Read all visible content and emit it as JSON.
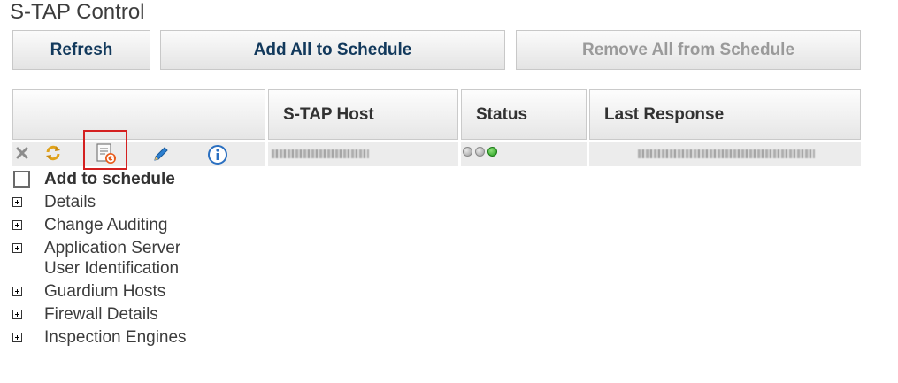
{
  "title": "S-TAP Control",
  "toolbar": {
    "refresh": "Refresh",
    "add_all": "Add All to Schedule",
    "remove_all": "Remove All from Schedule"
  },
  "table": {
    "columns": [
      "",
      "S-TAP Host",
      "Status",
      "Last Response"
    ],
    "row": {
      "actions": [
        "delete-icon",
        "refresh-sync-icon",
        "guardium-report-icon",
        "edit-pencil-icon",
        "info-icon"
      ],
      "status_dots": [
        "gray",
        "gray",
        "green"
      ],
      "colors": {
        "highlight": "#d42020",
        "ok": "#1f9a1a"
      }
    }
  },
  "schedule": {
    "label": "Add to schedule",
    "checked": false
  },
  "sections": [
    {
      "label": "Details"
    },
    {
      "label": "Change Auditing"
    },
    {
      "label_line1": "Application Server",
      "label_line2": "User Identification"
    },
    {
      "label": "Guardium Hosts"
    },
    {
      "label": "Firewall Details"
    },
    {
      "label": "Inspection Engines"
    }
  ]
}
